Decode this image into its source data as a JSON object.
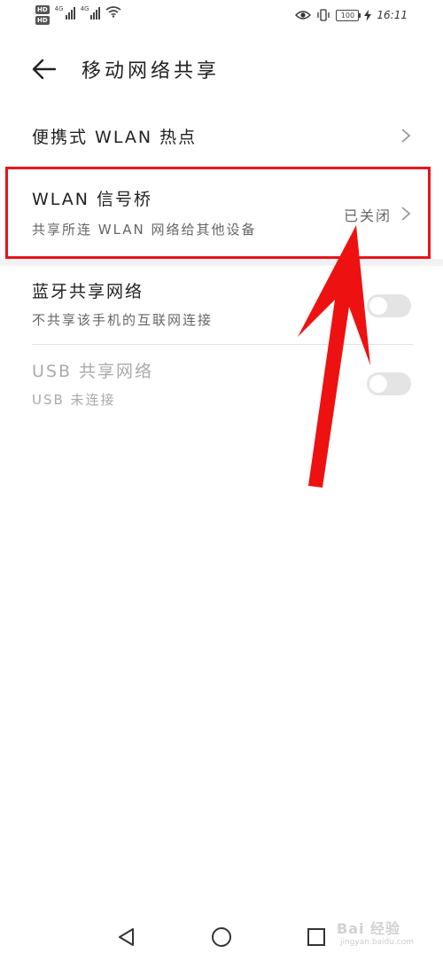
{
  "status_bar": {
    "network_badge_1": "HD",
    "network_badge_2": "HD",
    "signal_label_1": "4G",
    "signal_label_2": "4G",
    "battery_level": "100",
    "time": "16:11"
  },
  "header": {
    "title": "移动网络共享"
  },
  "list": {
    "hotspot": {
      "title": "便携式 WLAN 热点"
    },
    "wlan_bridge": {
      "title": "WLAN 信号桥",
      "subtitle": "共享所连 WLAN 网络给其他设备",
      "status": "已关闭"
    },
    "bluetooth_tethering": {
      "title": "蓝牙共享网络",
      "subtitle": "不共享该手机的互联网连接",
      "enabled": false
    },
    "usb_tethering": {
      "title": "USB 共享网络",
      "subtitle": "USB 未连接",
      "enabled": false
    }
  },
  "annotation": {
    "highlight_color": "#e8141c",
    "arrow_color": "#ee1111"
  },
  "watermark": {
    "text": "Bai 经验",
    "sub": "jingyan.baidu.com"
  },
  "icons": {
    "back": "arrow-left-icon",
    "chevron": "chevron-right-icon",
    "eye": "eye-icon",
    "vibrate": "vibrate-icon",
    "charging": "bolt-icon",
    "wifi": "wifi-icon"
  }
}
